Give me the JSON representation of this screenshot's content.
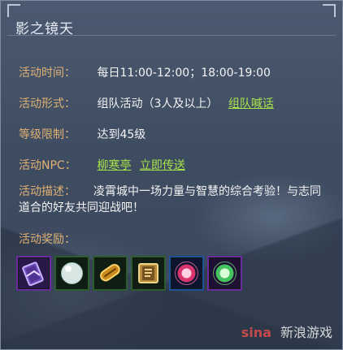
{
  "header": {
    "title": "影之镜天"
  },
  "info": {
    "time_label": "活动时间：",
    "time_value": "每日11:00-12:00；18:00-19:00",
    "form_label": "活动形式：",
    "form_value": "组队活动（3人及以上）",
    "form_link": "组队喊话",
    "level_label": "等级限制：",
    "level_value": "达到45级",
    "npc_label": "活动NPC：",
    "npc_name_link": "柳寒亭",
    "npc_teleport_link": "立即传送",
    "desc_label": "活动描述：",
    "desc_text": "凌霄城中一场力量与智慧的综合考验！与志同道合的好友共同迎战吧！",
    "reward_label": "活动奖励："
  },
  "rewards": [
    {
      "icon": "talisman-icon",
      "border": "#6c2aa0"
    },
    {
      "icon": "pearl-icon",
      "border": "#2f5c2f"
    },
    {
      "icon": "golden-scroll-icon",
      "border": "#2f5c2f"
    },
    {
      "icon": "book-icon",
      "border": "#2f5c2f"
    },
    {
      "icon": "fire-orb-icon",
      "border": "#1e4f9b"
    },
    {
      "icon": "green-orb-icon",
      "border": "#6c2aa0"
    }
  ],
  "watermark": {
    "logo": "sina",
    "text": "新浪游戏"
  }
}
